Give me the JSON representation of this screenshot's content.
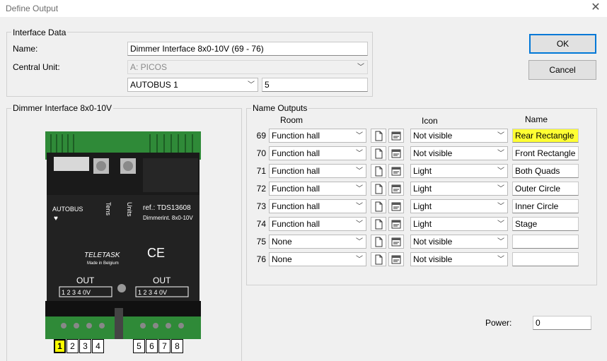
{
  "window": {
    "title": "Define Output",
    "close_icon": "close-icon"
  },
  "interface_data": {
    "group_label": "Interface Data",
    "name_label": "Name:",
    "name_value": "Dimmer Interface 8x0-10V (69 - 76)",
    "central_unit_label": "Central Unit:",
    "central_unit_value": "A: PICOS",
    "bus_value": "AUTOBUS 1",
    "address_value": "5"
  },
  "buttons": {
    "ok": "OK",
    "cancel": "Cancel"
  },
  "device_group": {
    "label": "Dimmer Interface 8x0-10V",
    "device": {
      "autobus": "AUTOBUS",
      "tens": "Tens",
      "units": "Units",
      "ref": "ref.: TDS13608",
      "model": "Dimmerint. 8x0-10V",
      "brand": "TELETASK",
      "made_in": "Made in Belgium",
      "ce": "CE",
      "out_left": "OUT",
      "out_right": "OUT",
      "out_terms": [
        "1",
        "2",
        "3",
        "4",
        "0V"
      ]
    },
    "terminals": [
      "1",
      "2",
      "3",
      "4",
      "5",
      "6",
      "7",
      "8"
    ],
    "highlight_terminal": "1"
  },
  "name_outputs": {
    "group_label": "Name Outputs",
    "headers": {
      "room": "Room",
      "icon": "Icon",
      "name": "Name"
    },
    "rows": [
      {
        "num": "69",
        "room": "Function hall",
        "icon": "Not visible",
        "name": "Rear Rectangle",
        "highlighted": true
      },
      {
        "num": "70",
        "room": "Function hall",
        "icon": "Not visible",
        "name": "Front Rectangle"
      },
      {
        "num": "71",
        "room": "Function hall",
        "icon": "Light",
        "name": "Both Quads"
      },
      {
        "num": "72",
        "room": "Function hall",
        "icon": "Light",
        "name": "Outer Circle"
      },
      {
        "num": "73",
        "room": "Function hall",
        "icon": "Light",
        "name": "Inner Circle"
      },
      {
        "num": "74",
        "room": "Function hall",
        "icon": "Light",
        "name": "Stage"
      },
      {
        "num": "75",
        "room": "None",
        "icon": "Not visible",
        "name": ""
      },
      {
        "num": "76",
        "room": "None",
        "icon": "Not visible",
        "name": ""
      }
    ]
  },
  "power": {
    "label": "Power:",
    "value": "0"
  },
  "colors": {
    "highlight": "#ffff33",
    "accent": "#0078d7",
    "device_green": "#2f8a38"
  }
}
